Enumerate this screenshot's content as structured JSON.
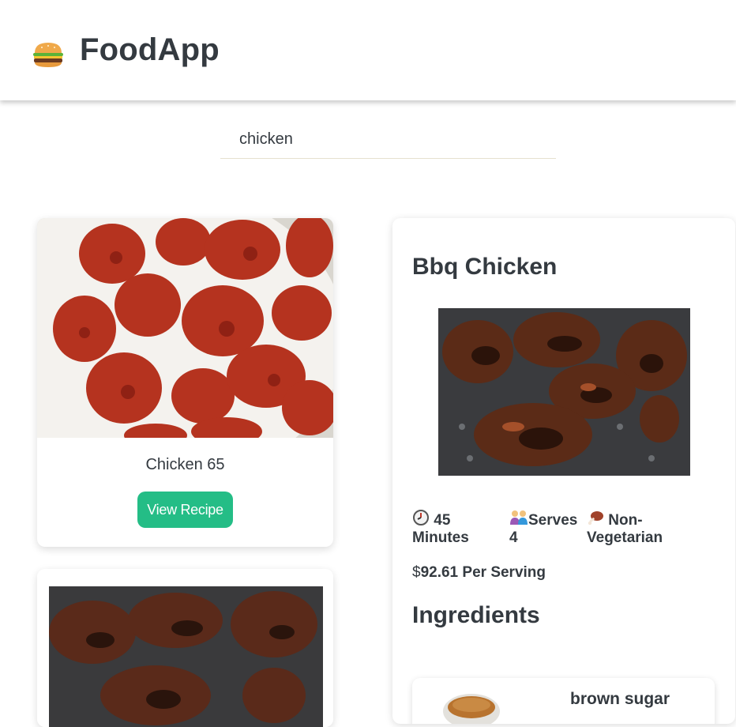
{
  "app": {
    "title": "FoodApp",
    "logo_icon": "burger-icon"
  },
  "search": {
    "value": "chicken"
  },
  "results": [
    {
      "title": "Chicken 65",
      "button_label": "View Recipe",
      "image": "fried-chicken-photo"
    },
    {
      "image": "bbq-chicken-photo"
    }
  ],
  "detail": {
    "title": "Bbq Chicken",
    "image": "bbq-chicken-photo",
    "time_icon": "clock-icon",
    "time_value": "45",
    "time_unit": "Minutes",
    "serves_icon": "people-icon",
    "serves_label": "Serves",
    "serves_value": "4",
    "diet_icon": "meat-icon",
    "diet_label": "Non-",
    "diet_label2": "Vegetarian",
    "price_symbol": "$",
    "price_text": "92.61 Per Serving",
    "ingredients_heading": "Ingredients",
    "ingredients": [
      {
        "name": "brown sugar",
        "image": "brown-sugar-photo"
      }
    ]
  },
  "colors": {
    "accent": "#24bd86",
    "text": "#343a40",
    "search_underline": "#e6e0cf"
  }
}
